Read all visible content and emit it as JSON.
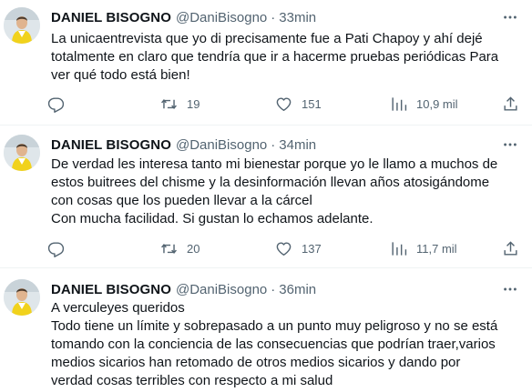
{
  "tweets": [
    {
      "name": "DANIEL BISOGNO",
      "handle": "@DaniBisogno",
      "separator": "·",
      "time": "33min",
      "lines": [
        "La unicaentrevista que yo di precisamente fue a Pati Chapoy y ahí dejé",
        "totalmente en claro que tendría que ir a hacerme pruebas periódicas Para",
        "ver qué todo está bien!"
      ],
      "retweets": "19",
      "likes": "151",
      "views": "10,9 mil"
    },
    {
      "name": "DANIEL BISOGNO",
      "handle": "@DaniBisogno",
      "separator": "·",
      "time": "34min",
      "lines": [
        "De verdad les interesa tanto mi bienestar porque yo le llamo a muchos de",
        "estos buitrees del chisme y la desinformación llevan años atosigándome",
        "con cosas que los pueden llevar a la cárcel",
        "Con mucha facilidad. Si gustan lo echamos adelante."
      ],
      "retweets": "20",
      "likes": "137",
      "views": "11,7 mil"
    },
    {
      "name": "DANIEL BISOGNO",
      "handle": "@DaniBisogno",
      "separator": "·",
      "time": "36min",
      "lines": [
        "A verculeyes queridos",
        "Todo tiene un límite y sobrepasado a un punto muy peligroso y no se está",
        "tomando con la conciencia de las consecuencias que podrían traer,varios",
        "medios sicarios han retomado de otros medios sicarios y dando por",
        "verdad cosas terribles con respecto  a mi salud"
      ]
    }
  ],
  "icons": {
    "avatar": "avatar-photo",
    "more": "more-horizontal-icon",
    "reply": "reply-icon",
    "retweet": "retweet-icon",
    "like": "heart-icon",
    "views": "views-icon",
    "share": "share-icon"
  },
  "colors": {
    "text": "#0f1419",
    "secondary": "#536471",
    "divider": "#eff3f4"
  }
}
